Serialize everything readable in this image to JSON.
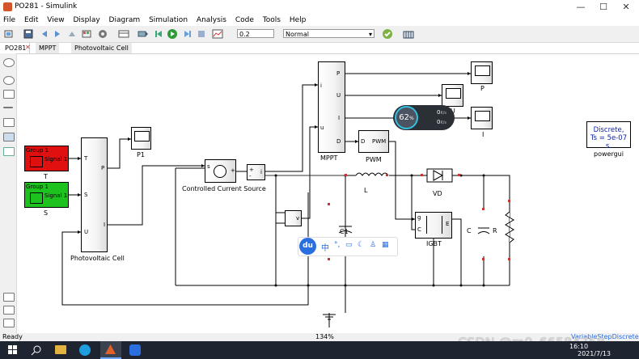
{
  "window": {
    "title": "PO281 - Simulink",
    "minimize": "—",
    "maximize": "☐",
    "close": "✕"
  },
  "menu": [
    "File",
    "Edit",
    "View",
    "Display",
    "Diagram",
    "Simulation",
    "Analysis",
    "Code",
    "Tools",
    "Help"
  ],
  "toolbar": {
    "stop_time": "0.2",
    "sim_mode": "Normal"
  },
  "tabs": [
    "PO281",
    "MPPT",
    "Photovoltaic Cell"
  ],
  "blocks": {
    "group1_T": {
      "line1": "Group 1",
      "line2": "Signal 1",
      "label": "T"
    },
    "group1_S": {
      "line1": "Group 1",
      "line2": "Signal 1",
      "label": "S"
    },
    "pv_cell": {
      "label": "Photovoltaic Cell",
      "ports_in": [
        "T",
        "S",
        "U"
      ],
      "ports_out": [
        "P",
        "I"
      ]
    },
    "scope_p1": "P1",
    "ccs": {
      "label": "Controlled Current Source",
      "s": "s",
      "plus": "+",
      "minus": "-"
    },
    "mppt": {
      "label": "MPPT",
      "in": [
        "i",
        "u"
      ],
      "out": [
        "P",
        "U",
        "I",
        "D"
      ]
    },
    "scope_p": "P",
    "scope_u": "U",
    "scope_i": "I",
    "pwm": {
      "label": "PWM",
      "d": "D",
      "pwm": "PWM"
    },
    "powergui": {
      "line1": "Discrete,",
      "line2": "Ts = 5e-07 s.",
      "label": "powergui"
    },
    "inductor": "L",
    "diode": "VD",
    "igbt": {
      "label": "IGBT",
      "g": "g",
      "c": "C",
      "e": "E"
    },
    "c1": "C1",
    "c": "C",
    "r": "R",
    "vm": "v",
    "im_plus": "+",
    "im_minus": "-",
    "im_i": "i"
  },
  "overlay": {
    "percent": "62",
    "unit": "%",
    "up": "0",
    "down": "0",
    "up_unit": "K/s",
    "down_unit": "K/s"
  },
  "ime": {
    "logo": "du",
    "zh": "中"
  },
  "status": {
    "left": "Ready",
    "zoom": "134%",
    "solver": "VariableStepDiscrete"
  },
  "watermark": "CSDN @m0_66584758",
  "clock": {
    "time": "16:10",
    "date": "2021/7/13"
  },
  "colors": {
    "red_block": "#e01010",
    "green_block": "#1ec21e",
    "wire": "#000000",
    "taskbar": "#1f2530"
  }
}
